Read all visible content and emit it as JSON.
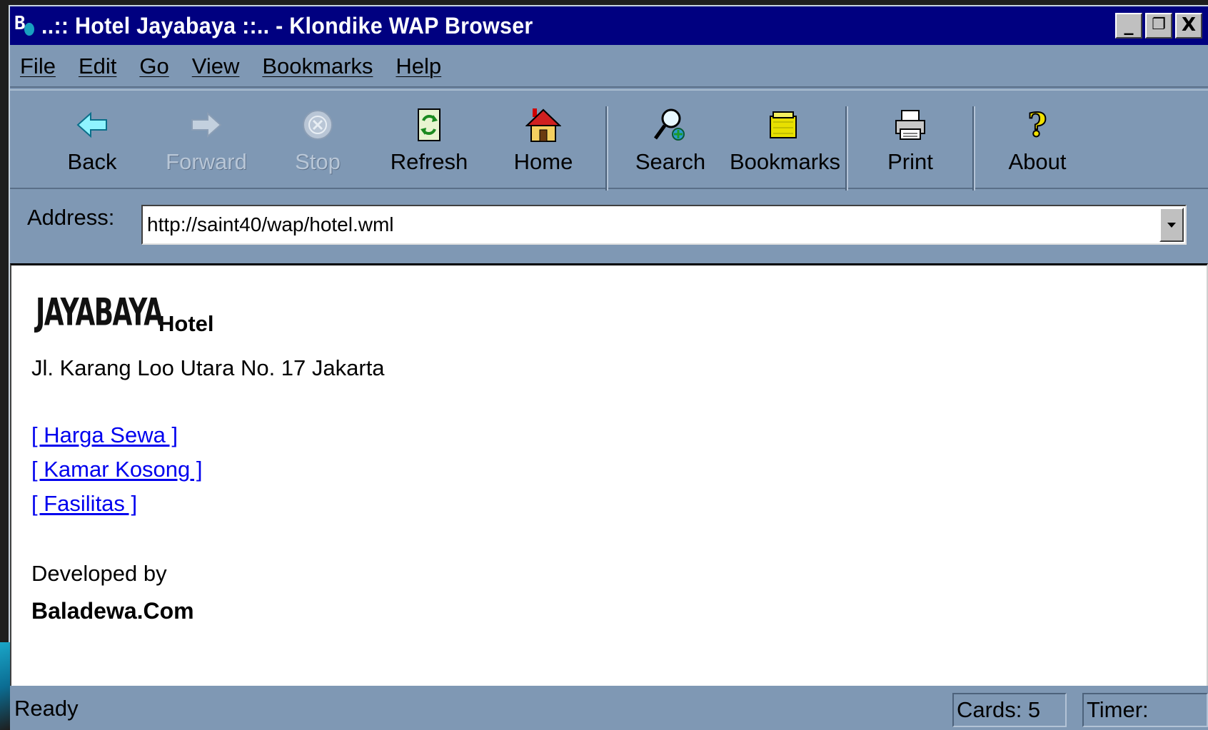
{
  "window": {
    "title": "..:: Hotel Jayabaya ::.. - Klondike WAP Browser",
    "controls": {
      "minimize": "_",
      "restore": "❐",
      "close": "X"
    }
  },
  "menu": [
    {
      "label": "File"
    },
    {
      "label": "Edit"
    },
    {
      "label": "Go"
    },
    {
      "label": "View"
    },
    {
      "label": "Bookmarks"
    },
    {
      "label": "Help"
    }
  ],
  "toolbar": {
    "back": "Back",
    "forward": "Forward",
    "stop": "Stop",
    "refresh": "Refresh",
    "home": "Home",
    "search": "Search",
    "bookmarks": "Bookmarks",
    "print": "Print",
    "about": "About"
  },
  "address": {
    "label": "Address:",
    "value": "http://saint40/wap/hotel.wml"
  },
  "page": {
    "logo_text": "JAYABAYA",
    "hotel_label": "Hotel",
    "address_line": "Jl. Karang Loo Utara No. 17 Jakarta",
    "links": [
      {
        "label": "[ Harga Sewa ]"
      },
      {
        "label": "[ Kamar Kosong ]"
      },
      {
        "label": "[ Fasilitas ]"
      }
    ],
    "developed_by": "Developed by",
    "developer": "Baladewa.Com"
  },
  "status": {
    "text": "Ready",
    "cards": "Cards: 5",
    "timer": "Timer:"
  },
  "colors": {
    "titlebar": "#000080",
    "chrome": "#7f98b4",
    "link": "#0000ee"
  }
}
